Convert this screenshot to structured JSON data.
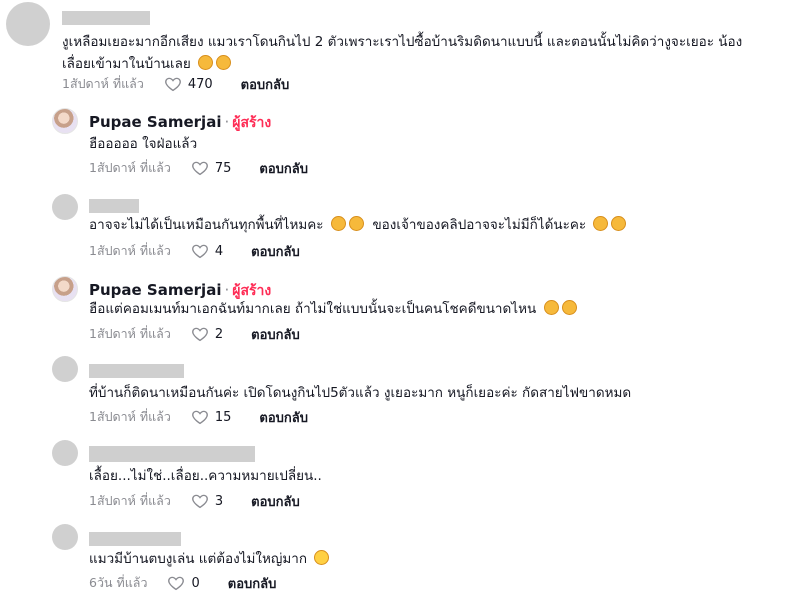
{
  "comments": [
    {
      "text": "งูเหลือมเยอะมากอีกเสียง แมวเราโดนกินไป 2 ตัวเพราะเราไปซื้อบ้านริมดิดนาแบบนี้ และตอนนั้นไม่คิดว่างูจะเยอะ น้องเลื่อยเข้ามาในบ้านเลย",
      "emojis": [
        "pleading-face",
        "pleading-face"
      ],
      "time": "1สัปดาห์ ที่แล้ว",
      "likes": "470",
      "reply_label": "ตอบกลับ"
    },
    {
      "username": "Pupae Samerjai",
      "separator": "·",
      "creator_tag": "ผู้สร้าง",
      "text": "ฮือออออ ใจฝ่อแล้ว",
      "time": "1สัปดาห์ ที่แล้ว",
      "likes": "75",
      "reply_label": "ตอบกลับ"
    },
    {
      "text": "อาจจะไม่ได้เป็นเหมือนกันทุกพื้นที่ไหมคะ",
      "text2": "ของเจ้าของคลิปอาจจะไม่มีก็ได้นะคะ",
      "emojis": [
        "pleading-face",
        "pleading-face"
      ],
      "emojis2": [
        "pleading-face",
        "pleading-face"
      ],
      "time": "1สัปดาห์ ที่แล้ว",
      "likes": "4",
      "reply_label": "ตอบกลับ"
    },
    {
      "username": "Pupae Samerjai",
      "separator": "·",
      "creator_tag": "ผู้สร้าง",
      "text": "ฮือแต่คอมเมนท์มาเอกฉันท์มากเลย ถ้าไม่ใช่แบบนั้นจะเป็นคนโชคดีขนาดไหน",
      "emojis": [
        "pleading-face",
        "pleading-face"
      ],
      "time": "1สัปดาห์ ที่แล้ว",
      "likes": "2",
      "reply_label": "ตอบกลับ"
    },
    {
      "text": "ที่บ้านก็ติดนาเหมือนกันค่ะ เปิดโดนงูกินไป5ตัวแล้ว งูเยอะมาก หนูก็เยอะค่ะ กัดสายไฟขาดหมด",
      "time": "1สัปดาห์ ที่แล้ว",
      "likes": "15",
      "reply_label": "ตอบกลับ"
    },
    {
      "text": "เลื้อย...ไม่ใช่..เลื่อย..ความหมายเปลี่ยน..",
      "time": "1สัปดาห์ ที่แล้ว",
      "likes": "3",
      "reply_label": "ตอบกลับ"
    },
    {
      "text": "แมวมีบ้านตบงูเล่น แต่ต้องไม่ใหญ่มาก",
      "emojis": [
        "laughing-face"
      ],
      "time": "6วัน ที่แล้ว",
      "likes": "0",
      "reply_label": "ตอบกลับ"
    }
  ],
  "colors": {
    "creator_tag": "#fe2c55",
    "meta_text": "#8a8b91",
    "redacted": "#cfcfcf",
    "avatar_placeholder": "#d0d0d0"
  }
}
